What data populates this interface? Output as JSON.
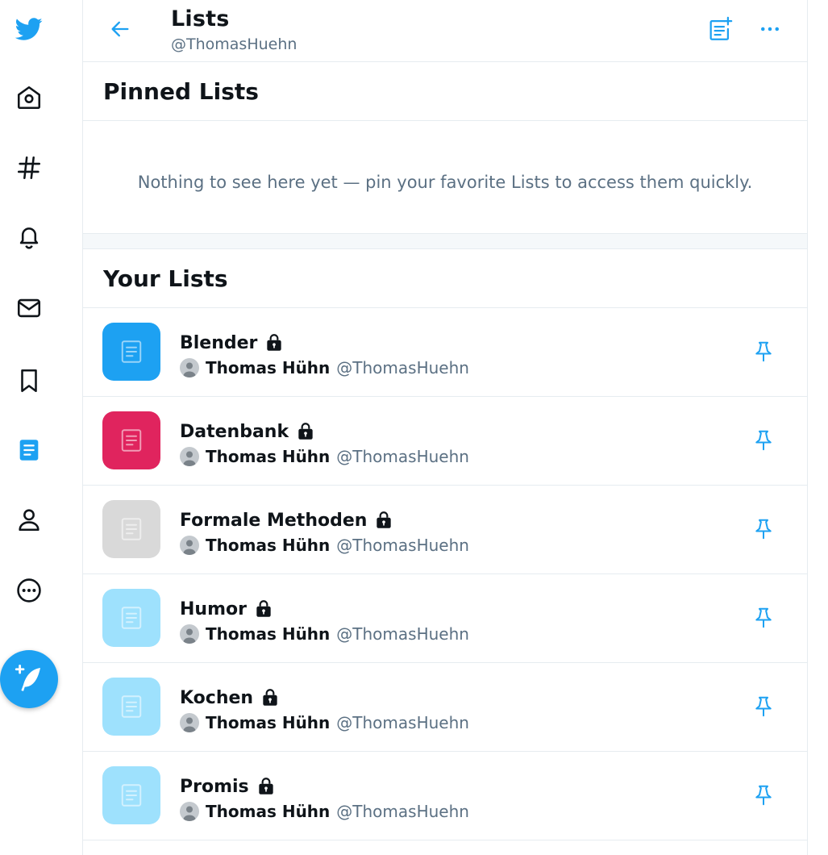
{
  "sidebar": {
    "items": [
      {
        "name": "twitter-logo-icon"
      },
      {
        "name": "home-icon"
      },
      {
        "name": "explore-hashtag-icon"
      },
      {
        "name": "notifications-bell-icon"
      },
      {
        "name": "messages-envelope-icon"
      },
      {
        "name": "bookmarks-icon"
      },
      {
        "name": "lists-icon",
        "active": true
      },
      {
        "name": "profile-icon"
      },
      {
        "name": "more-circle-icon"
      }
    ],
    "compose_icon": "compose-feather-icon"
  },
  "colors": {
    "accent": "#1da1f2",
    "text": "#0f1419",
    "secondary_text": "#5b7083"
  },
  "header": {
    "title": "Lists",
    "handle": "@ThomasHuehn"
  },
  "pinned": {
    "heading": "Pinned Lists",
    "empty_message": "Nothing to see here yet — pin your favorite Lists to access them quickly."
  },
  "your_lists": {
    "heading": "Your Lists",
    "items": [
      {
        "name": "Blender",
        "owner": "Thomas Hühn",
        "handle": "@ThomasHuehn",
        "color": "#1da1f2",
        "private": true
      },
      {
        "name": "Datenbank",
        "owner": "Thomas Hühn",
        "handle": "@ThomasHuehn",
        "color": "#e0245e",
        "private": true
      },
      {
        "name": "Formale Methoden",
        "owner": "Thomas Hühn",
        "handle": "@ThomasHuehn",
        "color": "#d9d9d9",
        "private": true
      },
      {
        "name": "Humor",
        "owner": "Thomas Hühn",
        "handle": "@ThomasHuehn",
        "color": "#9ee1fd",
        "private": true
      },
      {
        "name": "Kochen",
        "owner": "Thomas Hühn",
        "handle": "@ThomasHuehn",
        "color": "#9ee1fd",
        "private": true
      },
      {
        "name": "Promis",
        "owner": "Thomas Hühn",
        "handle": "@ThomasHuehn",
        "color": "#9ee1fd",
        "private": true
      }
    ]
  }
}
